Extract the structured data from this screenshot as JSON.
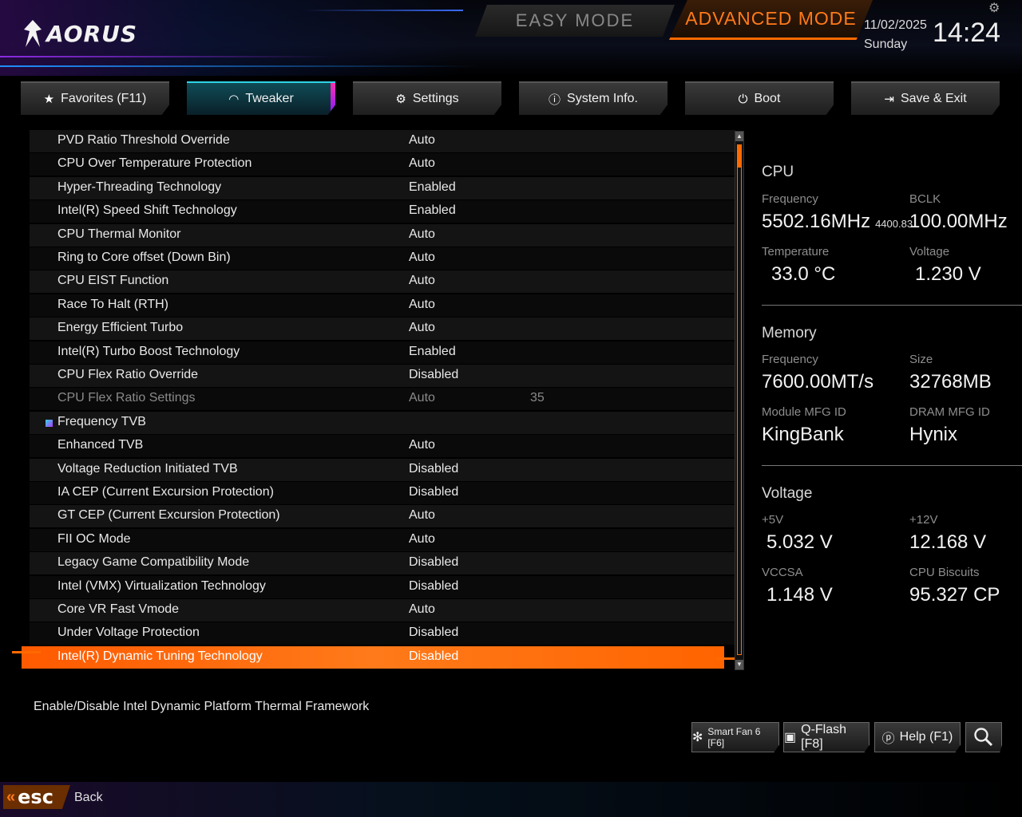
{
  "header": {
    "logo": "AORUS",
    "mode_easy": "EASY MODE",
    "mode_advanced": "ADVANCED MODE",
    "date": "11/02/2025",
    "day": "Sunday",
    "time": "14:24"
  },
  "tabs": [
    {
      "label": "Favorites (F11)",
      "icon": "star-folder-icon"
    },
    {
      "label": "Tweaker",
      "icon": "gauge-icon",
      "active": true
    },
    {
      "label": "Settings",
      "icon": "gear-icon"
    },
    {
      "label": "System Info.",
      "icon": "info-icon"
    },
    {
      "label": "Boot",
      "icon": "power-icon"
    },
    {
      "label": "Save & Exit",
      "icon": "exit-icon"
    }
  ],
  "settings": [
    {
      "label": "PVD Ratio Threshold Override",
      "value": "Auto"
    },
    {
      "label": "CPU Over Temperature Protection",
      "value": "Auto"
    },
    {
      "label": "Hyper-Threading Technology",
      "value": "Enabled"
    },
    {
      "label": "Intel(R) Speed Shift Technology",
      "value": "Enabled"
    },
    {
      "label": "CPU Thermal Monitor",
      "value": "Auto"
    },
    {
      "label": "Ring to Core offset (Down Bin)",
      "value": "Auto"
    },
    {
      "label": "CPU EIST Function",
      "value": "Auto"
    },
    {
      "label": "Race To Halt (RTH)",
      "value": "Auto"
    },
    {
      "label": "Energy Efficient Turbo",
      "value": "Auto"
    },
    {
      "label": "Intel(R) Turbo Boost Technology",
      "value": "Enabled"
    },
    {
      "label": "CPU Flex Ratio Override",
      "value": "Disabled"
    },
    {
      "label": "CPU Flex Ratio Settings",
      "value": "Auto",
      "value2": "35",
      "dim": true
    },
    {
      "label": "Frequency TVB",
      "value": "",
      "section": true
    },
    {
      "label": "Enhanced TVB",
      "value": "Auto"
    },
    {
      "label": "Voltage Reduction Initiated TVB",
      "value": "Disabled"
    },
    {
      "label": "IA CEP (Current Excursion Protection)",
      "value": "Disabled"
    },
    {
      "label": "GT CEP (Current Excursion Protection)",
      "value": "Auto"
    },
    {
      "label": "FII OC Mode",
      "value": "Auto"
    },
    {
      "label": "Legacy Game Compatibility Mode",
      "value": "Disabled"
    },
    {
      "label": "Intel (VMX) Virtualization Technology",
      "value": "Disabled"
    },
    {
      "label": "Core VR Fast Vmode",
      "value": "Auto"
    },
    {
      "label": "Under Voltage Protection",
      "value": "Disabled"
    },
    {
      "label": "Intel(R) Dynamic Tuning Technology",
      "value": "Disabled",
      "selected": true
    }
  ],
  "monitor": {
    "cpu": {
      "title": "CPU",
      "frequency_label": "Frequency",
      "frequency": "5502.16MHz",
      "frequency_sub": "4400.83",
      "bclk_label": "BCLK",
      "bclk": "100.00MHz",
      "temperature_label": "Temperature",
      "temperature": "33.0 °C",
      "voltage_label": "Voltage",
      "voltage": "1.230 V"
    },
    "memory": {
      "title": "Memory",
      "frequency_label": "Frequency",
      "frequency": "7600.00MT/s",
      "size_label": "Size",
      "size": "32768MB",
      "module_label": "Module MFG ID",
      "module": "KingBank",
      "dram_label": "DRAM MFG ID",
      "dram": "Hynix"
    },
    "voltage": {
      "title": "Voltage",
      "v5_label": "+5V",
      "v5": "5.032 V",
      "v12_label": "+12V",
      "v12": "12.168 V",
      "vccsa_label": "VCCSA",
      "vccsa": "1.148 V",
      "biscuits_label": "CPU Biscuits",
      "biscuits": "95.327 CP"
    }
  },
  "help_text": "Enable/Disable Intel Dynamic Platform Thermal Framework",
  "footer": {
    "smart_fan": "Smart Fan 6 [F6]",
    "qflash": "Q-Flash [F8]",
    "help": "Help (F1)",
    "esc": "esc",
    "back": "Back"
  },
  "colors": {
    "accent_orange": "#ff6a00",
    "accent_cyan": "#2fd6e6",
    "accent_pink": "#ff2fb0"
  }
}
